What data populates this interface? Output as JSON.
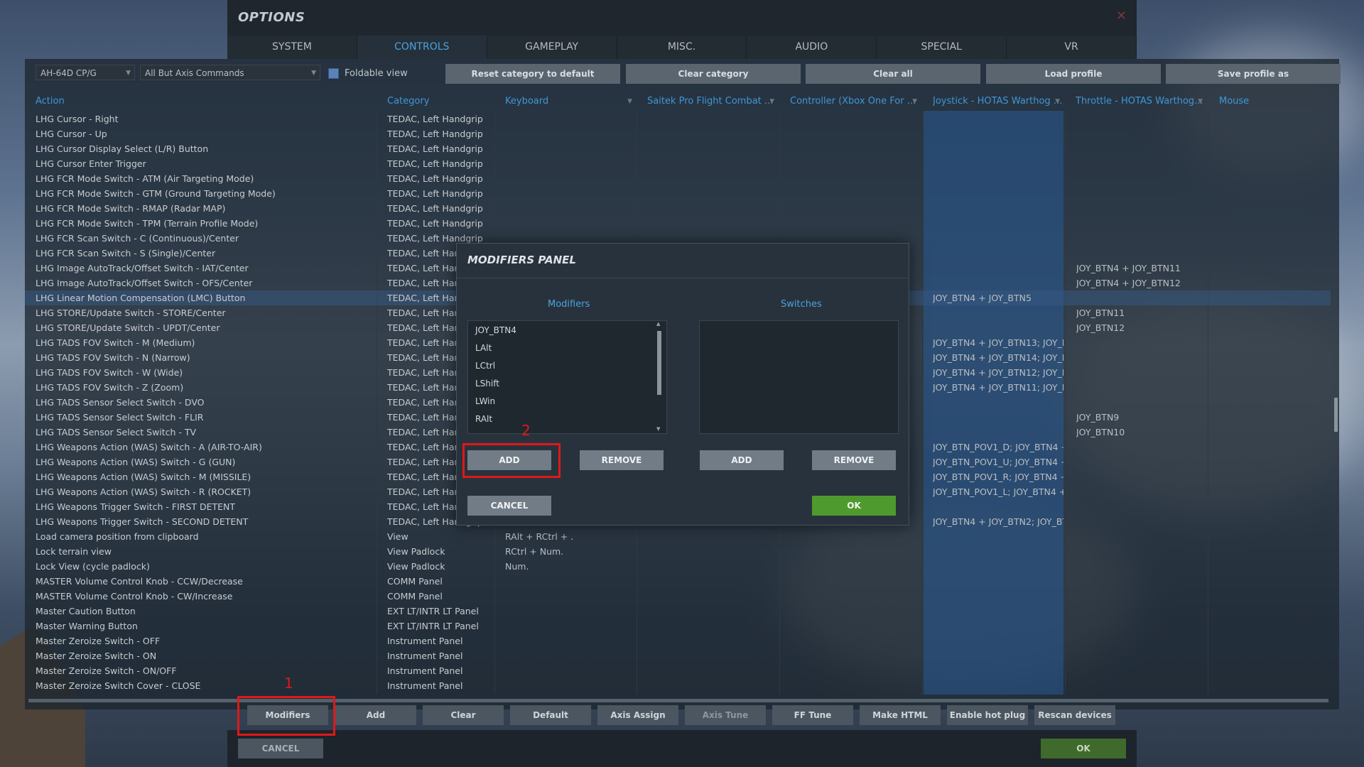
{
  "window": {
    "title": "OPTIONS",
    "close_icon": "close-icon"
  },
  "tabs": [
    "SYSTEM",
    "CONTROLS",
    "GAMEPLAY",
    "MISC.",
    "AUDIO",
    "SPECIAL",
    "VR"
  ],
  "toolbar": {
    "aircraft": "AH-64D CP/G",
    "category_filter": "All But Axis Commands",
    "foldable_label": "Foldable view",
    "buttons": [
      "Reset category to default",
      "Clear category",
      "Clear all",
      "Load profile",
      "Save profile as"
    ]
  },
  "columns": [
    "Action",
    "Category",
    "Keyboard",
    "Saitek Pro Flight Combat ...",
    "Controller (Xbox One For ...",
    "Joystick - HOTAS Warthog ...",
    "Throttle - HOTAS Warthog...",
    "Mouse"
  ],
  "rows": [
    {
      "action": "LHG Cursor - Right",
      "category": "TEDAC, Left Handgrip",
      "keyboard": "",
      "joystick": "",
      "throttle": ""
    },
    {
      "action": "LHG Cursor - Up",
      "category": "TEDAC, Left Handgrip",
      "keyboard": "",
      "joystick": "",
      "throttle": ""
    },
    {
      "action": "LHG Cursor Display Select (L/R) Button",
      "category": "TEDAC, Left Handgrip",
      "keyboard": "",
      "joystick": "",
      "throttle": ""
    },
    {
      "action": "LHG Cursor Enter Trigger",
      "category": "TEDAC, Left Handgrip",
      "keyboard": "",
      "joystick": "",
      "throttle": ""
    },
    {
      "action": "LHG FCR Mode Switch - ATM (Air Targeting Mode)",
      "category": "TEDAC, Left Handgrip",
      "keyboard": "",
      "joystick": "",
      "throttle": ""
    },
    {
      "action": "LHG FCR Mode Switch - GTM (Ground Targeting Mode)",
      "category": "TEDAC, Left Handgrip",
      "keyboard": "",
      "joystick": "",
      "throttle": ""
    },
    {
      "action": "LHG FCR Mode Switch - RMAP (Radar MAP)",
      "category": "TEDAC, Left Handgrip",
      "keyboard": "",
      "joystick": "",
      "throttle": ""
    },
    {
      "action": "LHG FCR Mode Switch - TPM (Terrain Profile Mode)",
      "category": "TEDAC, Left Handgrip",
      "keyboard": "",
      "joystick": "",
      "throttle": ""
    },
    {
      "action": "LHG FCR Scan Switch - C (Continuous)/Center",
      "category": "TEDAC, Left Handgrip",
      "keyboard": "",
      "joystick": "",
      "throttle": ""
    },
    {
      "action": "LHG FCR Scan Switch - S (Single)/Center",
      "category": "TEDAC, Left Handgrip",
      "keyboard": "",
      "joystick": "",
      "throttle": ""
    },
    {
      "action": "LHG Image AutoTrack/Offset Switch - IAT/Center",
      "category": "TEDAC, Left Handgrip",
      "keyboard": "",
      "joystick": "",
      "throttle": "JOY_BTN4 + JOY_BTN11"
    },
    {
      "action": "LHG Image AutoTrack/Offset Switch - OFS/Center",
      "category": "TEDAC, Left Handgrip",
      "keyboard": "",
      "joystick": "",
      "throttle": "JOY_BTN4 + JOY_BTN12"
    },
    {
      "action": "LHG Linear Motion Compensation (LMC) Button",
      "category": "TEDAC, Left Handgrip",
      "keyboard": "",
      "joystick": "JOY_BTN4 + JOY_BTN5",
      "throttle": ""
    },
    {
      "action": "LHG STORE/Update Switch - STORE/Center",
      "category": "TEDAC, Left Handgrip",
      "keyboard": "",
      "joystick": "",
      "throttle": "JOY_BTN11"
    },
    {
      "action": "LHG STORE/Update Switch - UPDT/Center",
      "category": "TEDAC, Left Handgrip",
      "keyboard": "",
      "joystick": "",
      "throttle": "JOY_BTN12"
    },
    {
      "action": "LHG TADS FOV Switch - M (Medium)",
      "category": "TEDAC, Left Handgrip",
      "keyboard": "",
      "joystick": "JOY_BTN4 + JOY_BTN13; JOY_BT",
      "throttle": ""
    },
    {
      "action": "LHG TADS FOV Switch - N (Narrow)",
      "category": "TEDAC, Left Handgrip",
      "keyboard": "",
      "joystick": "JOY_BTN4 + JOY_BTN14; JOY_BT",
      "throttle": ""
    },
    {
      "action": "LHG TADS FOV Switch - W (Wide)",
      "category": "TEDAC, Left Handgrip",
      "keyboard": "",
      "joystick": "JOY_BTN4 + JOY_BTN12; JOY_BT",
      "throttle": ""
    },
    {
      "action": "LHG TADS FOV Switch - Z (Zoom)",
      "category": "TEDAC, Left Handgrip",
      "keyboard": "",
      "joystick": "JOY_BTN4 + JOY_BTN11; JOY_BT",
      "throttle": ""
    },
    {
      "action": "LHG TADS Sensor Select Switch - DVO",
      "category": "TEDAC, Left Handgrip",
      "keyboard": "",
      "joystick": "",
      "throttle": ""
    },
    {
      "action": "LHG TADS Sensor Select Switch - FLIR",
      "category": "TEDAC, Left Handgrip",
      "keyboard": "",
      "joystick": "",
      "throttle": "JOY_BTN9"
    },
    {
      "action": "LHG TADS Sensor Select Switch - TV",
      "category": "TEDAC, Left Handgrip",
      "keyboard": "",
      "joystick": "",
      "throttle": "JOY_BTN10"
    },
    {
      "action": "LHG Weapons Action (WAS) Switch - A (AIR-TO-AIR)",
      "category": "TEDAC, Left Handgrip",
      "keyboard": "",
      "joystick": "JOY_BTN_POV1_D; JOY_BTN4 + J",
      "throttle": ""
    },
    {
      "action": "LHG Weapons Action (WAS) Switch - G (GUN)",
      "category": "TEDAC, Left Handgrip",
      "keyboard": "",
      "joystick": "JOY_BTN_POV1_U; JOY_BTN4 + J",
      "throttle": ""
    },
    {
      "action": "LHG Weapons Action (WAS) Switch - M (MISSILE)",
      "category": "TEDAC, Left Handgrip",
      "keyboard": "",
      "joystick": "JOY_BTN_POV1_R; JOY_BTN4 + J",
      "throttle": ""
    },
    {
      "action": "LHG Weapons Action (WAS) Switch - R (ROCKET)",
      "category": "TEDAC, Left Handgrip",
      "keyboard": "",
      "joystick": "JOY_BTN_POV1_L; JOY_BTN4 + J",
      "throttle": ""
    },
    {
      "action": "LHG Weapons Trigger Switch - FIRST DETENT",
      "category": "TEDAC, Left Handgrip",
      "keyboard": "",
      "joystick": "",
      "throttle": ""
    },
    {
      "action": "LHG Weapons Trigger Switch - SECOND DETENT",
      "category": "TEDAC, Left Handgrip",
      "keyboard": "",
      "joystick": "JOY_BTN4 + JOY_BTN2; JOY_BTN",
      "throttle": ""
    },
    {
      "action": "Load camera position from clipboard",
      "category": "View",
      "keyboard": "RAlt + RCtrl + .",
      "joystick": "",
      "throttle": ""
    },
    {
      "action": "Lock terrain view",
      "category": "View Padlock",
      "keyboard": "RCtrl + Num.",
      "joystick": "",
      "throttle": ""
    },
    {
      "action": "Lock View (cycle padlock)",
      "category": "View Padlock",
      "keyboard": "Num.",
      "joystick": "",
      "throttle": ""
    },
    {
      "action": "MASTER Volume Control Knob - CCW/Decrease",
      "category": "COMM Panel",
      "keyboard": "",
      "joystick": "",
      "throttle": ""
    },
    {
      "action": "MASTER Volume Control Knob - CW/Increase",
      "category": "COMM Panel",
      "keyboard": "",
      "joystick": "",
      "throttle": ""
    },
    {
      "action": "Master Caution Button",
      "category": "EXT LT/INTR LT Panel",
      "keyboard": "",
      "joystick": "",
      "throttle": ""
    },
    {
      "action": "Master Warning Button",
      "category": "EXT LT/INTR LT Panel",
      "keyboard": "",
      "joystick": "",
      "throttle": ""
    },
    {
      "action": "Master Zeroize Switch - OFF",
      "category": "Instrument Panel",
      "keyboard": "",
      "joystick": "",
      "throttle": ""
    },
    {
      "action": "Master Zeroize Switch - ON",
      "category": "Instrument Panel",
      "keyboard": "",
      "joystick": "",
      "throttle": ""
    },
    {
      "action": "Master Zeroize Switch - ON/OFF",
      "category": "Instrument Panel",
      "keyboard": "",
      "joystick": "",
      "throttle": ""
    },
    {
      "action": "Master Zeroize Switch Cover - CLOSE",
      "category": "Instrument Panel",
      "keyboard": "",
      "joystick": "",
      "throttle": ""
    }
  ],
  "bottom_buttons": [
    "Modifiers",
    "Add",
    "Clear",
    "Default",
    "Axis Assign",
    "Axis Tune",
    "FF Tune",
    "Make HTML",
    "Enable hot plug",
    "Rescan devices"
  ],
  "footer": {
    "cancel": "CANCEL",
    "ok": "OK"
  },
  "modal": {
    "title": "MODIFIERS PANEL",
    "modifiers_header": "Modifiers",
    "switches_header": "Switches",
    "modifiers": [
      "JOY_BTN4",
      "LAlt",
      "LCtrl",
      "LShift",
      "LWin",
      "RAlt"
    ],
    "switches": [],
    "add": "ADD",
    "remove": "REMOVE",
    "cancel": "CANCEL",
    "ok": "OK"
  },
  "annotations": [
    "1",
    "2"
  ]
}
